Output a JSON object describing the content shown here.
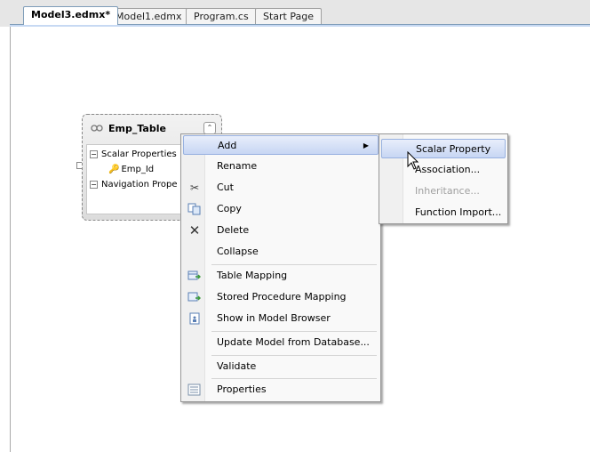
{
  "tabs": [
    {
      "label": "Model3.edmx*"
    },
    {
      "label": "Model1.edmx"
    },
    {
      "label": "Program.cs"
    },
    {
      "label": "Start Page"
    }
  ],
  "entity": {
    "title": "Emp_Table",
    "scalar_section": "Scalar Properties",
    "key_property": "Emp_Id",
    "navigation_section": "Navigation Prope"
  },
  "context_menu": {
    "items": [
      {
        "label": "Add",
        "icon": ""
      },
      {
        "label": "Rename",
        "icon": ""
      },
      {
        "label": "Cut",
        "icon": "scissors-icon"
      },
      {
        "label": "Copy",
        "icon": "copy-icon"
      },
      {
        "label": "Delete",
        "icon": "delete-x-icon"
      },
      {
        "label": "Collapse",
        "icon": ""
      },
      {
        "label": "Table Mapping",
        "icon": "table-mapping-icon"
      },
      {
        "label": "Stored Procedure Mapping",
        "icon": "stored-procedure-icon"
      },
      {
        "label": "Show in Model Browser",
        "icon": "model-browser-icon"
      },
      {
        "label": "Update Model from Database...",
        "icon": ""
      },
      {
        "label": "Validate",
        "icon": ""
      },
      {
        "label": "Properties",
        "icon": "properties-icon"
      }
    ]
  },
  "submenu": {
    "items": [
      {
        "label": "Scalar Property",
        "enabled": true
      },
      {
        "label": "Association...",
        "enabled": true
      },
      {
        "label": "Inheritance...",
        "enabled": false
      },
      {
        "label": "Function Import...",
        "enabled": true
      }
    ]
  },
  "colors": {
    "highlight": "#c7d6f3",
    "highlight_border": "#98b1e0",
    "disabled_text": "#a0a0a0"
  }
}
